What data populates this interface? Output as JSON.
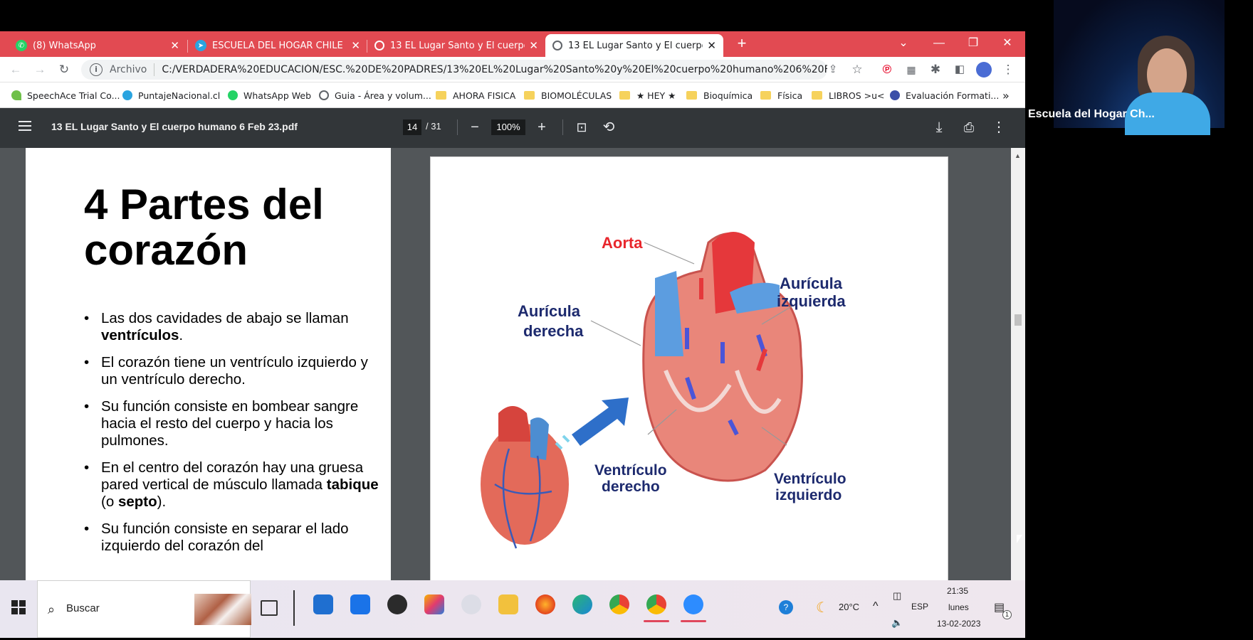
{
  "tabs": [
    {
      "title": "(8) WhatsApp",
      "icon": "whatsapp-icon"
    },
    {
      "title": "ESCUELA DEL HOGAR CHILE",
      "icon": "telegram-icon"
    },
    {
      "title": "13 EL Lugar Santo y El cuerpo hu",
      "icon": "globe-icon"
    },
    {
      "title": "13 EL Lugar Santo y El cuerpo hu",
      "icon": "globe-icon",
      "active": true
    }
  ],
  "toolbar": {
    "scheme_label": "Archivo",
    "url": "C:/VERDADERA%20EDUCACIÓN/ESC.%20DE%20PADRES/13%20EL%20Lugar%20Santo%20y%20El%20cuerpo%20humano%206%20Feb%2023..."
  },
  "bookmarks": [
    "SpeechAce Trial Co...",
    "PuntajeNacional.cl",
    "WhatsApp Web",
    "Guia - Área y volum...",
    "AHORA FISICA",
    "BIOMOLÉCULAS",
    "★ HEY ★",
    "Bioquímica",
    "Física",
    "LIBROS >u<",
    "Evaluación Formati..."
  ],
  "bookmarks_more": "»",
  "pdf": {
    "title": "13 EL Lugar Santo y El cuerpo humano 6 Feb 23.pdf",
    "page_current": "14",
    "page_total": "/ 31",
    "zoom": "100%"
  },
  "slide": {
    "title_line1": "4 Partes del",
    "title_line2": "corazón",
    "bullets": [
      [
        "Las dos cavidades de abajo se llaman ",
        "ventrículos",
        "."
      ],
      [
        " El corazón tiene un ventrículo izquierdo y un ventrículo derecho.",
        "",
        ""
      ],
      [
        "Su función consiste en bombear sangre hacia el resto del cuerpo y hacia los pulmones.",
        "",
        ""
      ],
      [
        "En el centro del corazón hay una gruesa pared vertical de músculo llamada ",
        "tabique",
        " (o "
      ],
      [
        "Su función consiste en separar el lado izquierdo del corazón del",
        "",
        ""
      ]
    ],
    "bullet4_tail_bold": "septo",
    "bullet4_tail_end": ")."
  },
  "diagram": {
    "aorta": "Aorta",
    "auricula_izq_1": "Aurícula",
    "auricula_izq_2": "izquierda",
    "auricula_der_1": "Aurícula",
    "auricula_der_2": "derecha",
    "ventriculo_der_1": "Ventrículo",
    "ventriculo_der_2": "derecho",
    "ventriculo_izq_1": "Ventrículo",
    "ventriculo_izq_2": "izquierdo",
    "red_label_color": "#e8262c",
    "blue_label_color": "#1d2a6e"
  },
  "taskbar": {
    "search_label": "Buscar",
    "temperature": "20°C",
    "language": "ESP",
    "time": "21:35",
    "day": "lunes",
    "date": "13-02-2023",
    "notifications": "1"
  },
  "webcam": {
    "name": "Escuela del Hogar Ch..."
  },
  "colors": {
    "tabbar": "#e24a52",
    "pdf_toolbar": "#323639",
    "pdf_bg": "#525659"
  }
}
